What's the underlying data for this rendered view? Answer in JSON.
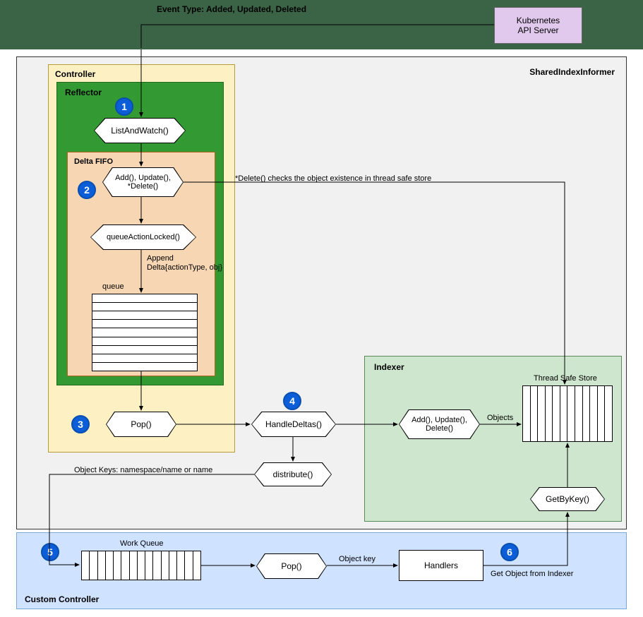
{
  "top_bar": {
    "event_label": "Event Type: Added, Updated, Deleted",
    "api_server": "Kubernetes\nAPI Server"
  },
  "shared_informer": {
    "title": "SharedIndexInformer",
    "controller": {
      "title": "Controller",
      "reflector": {
        "title": "Reflector",
        "list_watch": "ListAndWatch()",
        "delta_fifo": {
          "title": "Delta FIFO",
          "add_update_delete": "Add(), Update(),\n*Delete()",
          "queue_action": "queueActionLocked()",
          "append_label": "Append\nDelta{actionType, obj}",
          "queue_label": "queue"
        }
      },
      "pop": "Pop()"
    },
    "delete_note": "*Delete() checks the object existence in thread safe store",
    "handle_deltas": "HandleDeltas()",
    "distribute": "distribute()",
    "object_keys_label": "Object Keys: namespace/name or name",
    "indexer": {
      "title": "Indexer",
      "add_update_delete": "Add(), Update(),\nDelete()",
      "objects_label": "Objects",
      "store_label": "Thread Safe Store",
      "get_by_key": "GetByKey()"
    }
  },
  "custom_controller": {
    "title": "Custom Controller",
    "work_queue_label": "Work Queue",
    "pop": "Pop()",
    "object_key_label": "Object key",
    "handlers": "Handlers",
    "get_object_label": "Get Object from Indexer"
  },
  "badges": {
    "b1": "1",
    "b2": "2",
    "b3": "3",
    "b4": "4",
    "b5": "5",
    "b6": "6"
  }
}
